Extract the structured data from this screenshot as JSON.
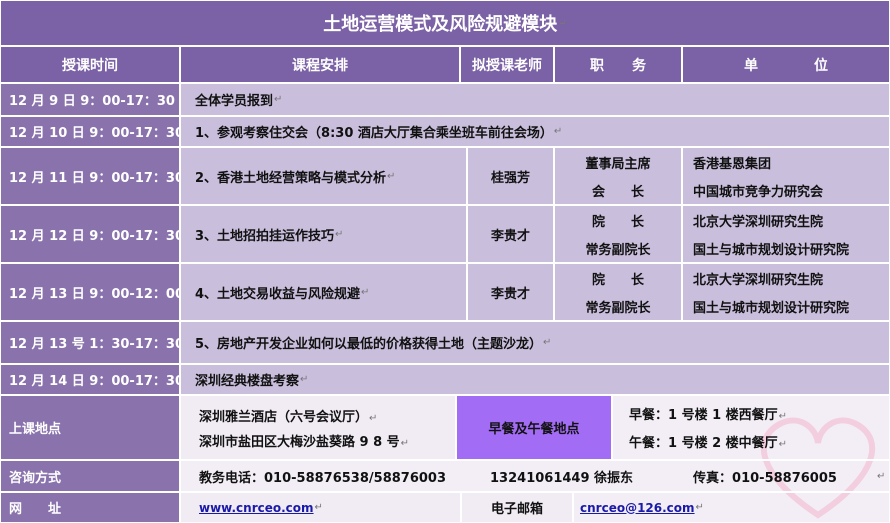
{
  "title": "土地运营模式及风险规避模块",
  "headers": {
    "time": "授课时间",
    "course": "课程安排",
    "teacher": "拟授课老师",
    "position": "职　　务",
    "unit": "单　　　　位"
  },
  "rows": {
    "r1": {
      "time": "12 月 9 日 9：00-17：30",
      "course": "全体学员报到"
    },
    "r2": {
      "time": "12 月 10 日 9：00-17：30",
      "course": "1、参观考察住交会（8:30 酒店大厅集合乘坐班车前往会场）"
    },
    "r3": {
      "time": "12 月 11 日 9：00-17：30",
      "course": "2、香港土地经营策略与模式分析",
      "teacher": "桂强芳",
      "pos1": "董事局主席",
      "pos2": "会　　长",
      "unit1": "香港基恩集团",
      "unit2": "中国城市竞争力研究会"
    },
    "r4": {
      "time": "12 月 12 日 9：00-17：30",
      "course": "3、土地招拍挂运作技巧",
      "teacher": "李贵才",
      "pos1": "院　　长",
      "pos2": "常务副院长",
      "unit1": "北京大学深圳研究生院",
      "unit2": "国土与城市规划设计研究院"
    },
    "r5": {
      "time": "12 月 13 日 9：00-12：00",
      "course": "4、土地交易收益与风险规避",
      "teacher": "李贵才",
      "pos1": "院　　长",
      "pos2": "常务副院长",
      "unit1": "北京大学深圳研究生院",
      "unit2": "国土与城市规划设计研究院"
    },
    "r6": {
      "time": "12 月 13 号 1：30-17：30",
      "course": "5、房地产开发企业如何以最低的价格获得土地（主题沙龙）"
    },
    "r7": {
      "time": "12 月 14 日 9：00-17：30",
      "course": "深圳经典楼盘考察"
    }
  },
  "venue": {
    "label": "上课地点",
    "line1": "深圳雅兰酒店（六号会议厅）",
    "line2": "深圳市盐田区大梅沙盐葵路 9 8 号",
    "meal_label": "早餐及午餐地点",
    "meal1": "早餐：1 号楼 1 楼西餐厅",
    "meal2": "午餐：1 号楼 2 楼中餐厅"
  },
  "contact": {
    "label": "咨询方式",
    "phone": "教务电话：010-58876538/58876003",
    "mobile": "13241061449 徐振东",
    "fax": "传真：010-58876005"
  },
  "web": {
    "label": "网　　址",
    "url": "www.cnrceo.com",
    "email_label": "电子邮箱",
    "email": "cnrceo@126.com"
  },
  "return_mark": "↵",
  "colors": {
    "header": "#7b61a5",
    "date_cell": "#8a73ad",
    "lavender": "#c9bedc",
    "light": "#f1ebf4",
    "meal_highlight": "#a36cf5",
    "link": "#1a1aa8"
  }
}
